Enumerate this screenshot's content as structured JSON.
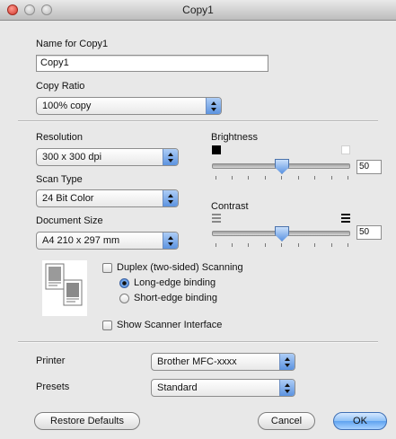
{
  "window": {
    "title": "Copy1"
  },
  "name_section": {
    "label": "Name for Copy1",
    "value": "Copy1"
  },
  "copy_ratio": {
    "label": "Copy Ratio",
    "selected": "100% copy"
  },
  "resolution": {
    "label": "Resolution",
    "selected": "300 x 300 dpi"
  },
  "scan_type": {
    "label": "Scan Type",
    "selected": "24 Bit Color"
  },
  "document_size": {
    "label": "Document Size",
    "selected": "A4  210 x 297 mm"
  },
  "brightness": {
    "label": "Brightness",
    "value": "50",
    "level": 0.5
  },
  "contrast": {
    "label": "Contrast",
    "value": "50",
    "level": 0.5
  },
  "duplex": {
    "checkbox_label": "Duplex (two-sided) Scanning",
    "checked": false,
    "options": [
      "Long-edge binding",
      "Short-edge binding"
    ],
    "selected": "Long-edge binding"
  },
  "show_scanner": {
    "label": "Show Scanner Interface",
    "checked": false
  },
  "printer": {
    "label": "Printer",
    "selected": "Brother MFC-xxxx"
  },
  "presets": {
    "label": "Presets",
    "selected": "Standard"
  },
  "buttons": {
    "restore": "Restore Defaults",
    "cancel": "Cancel",
    "ok": "OK"
  },
  "colors": {
    "window_bg": "#e8e8e8",
    "accent_blue": "#5c93e0",
    "close_red": "#d0352a"
  }
}
